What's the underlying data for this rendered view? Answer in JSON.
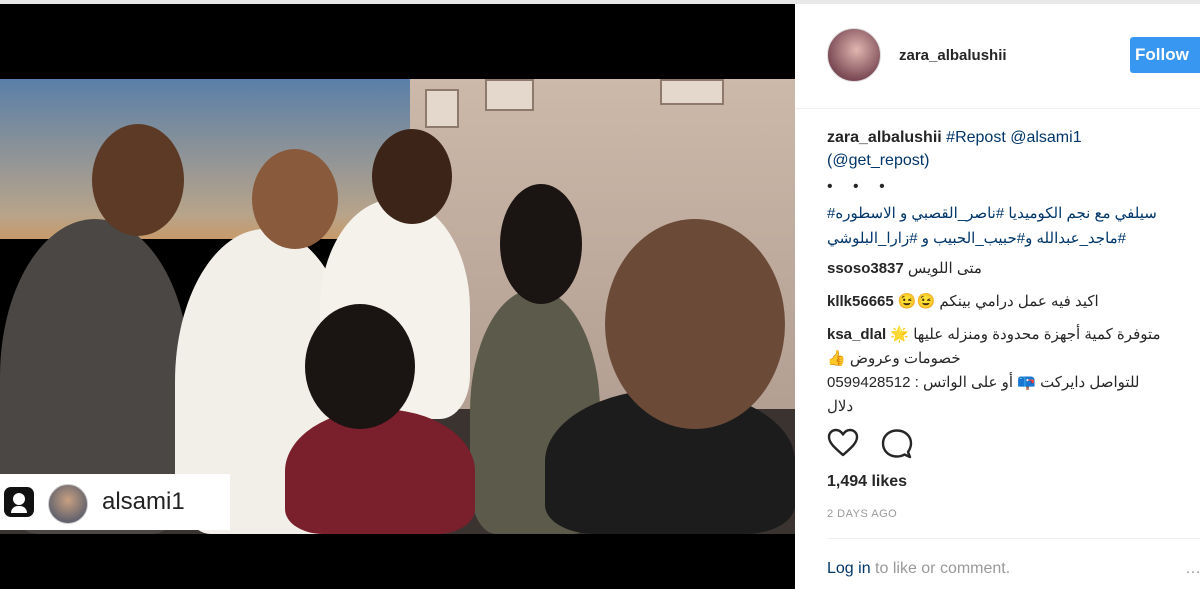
{
  "post": {
    "username": "zara_albalushii",
    "follow_label": "Follow",
    "repost_username": "alsami1"
  },
  "caption": {
    "username": "zara_albalushii",
    "text_part1": "#Repost @alsami1",
    "text_part2": "(@get_repost)",
    "dots": "• • •",
    "arabic_line1": "سيلفي مع نجم الكوميديا #ناصر_القصبي و الاسطوره#",
    "arabic_line2": "#ماجد_عبدالله و#حبيب_الحبيب و #زارا_البلوشي"
  },
  "comments": [
    {
      "username": "ssoso3837",
      "text": "متى اللويس"
    },
    {
      "username": "kllk56665",
      "text": "اكيد فيه عمل درامي بينكم 😉😉"
    },
    {
      "username": "ksa_dlal",
      "text": "متوفرة كمية أجهزة محدودة ومنزله عليها 🌟"
    },
    {
      "username": "",
      "text": "خصومات وعروض 👍"
    },
    {
      "username": "",
      "text": "للتواصل دايركت 📪 أو على الواتس : 0599428512"
    },
    {
      "username": "",
      "text": "دلال"
    }
  ],
  "stats": {
    "likes": "1,494 likes",
    "time_ago": "2 DAYS AGO"
  },
  "footer": {
    "login_link": "Log in",
    "login_rest": " to like or comment.",
    "more": "…"
  },
  "icons": {
    "like": "heart-icon",
    "comment": "comment-icon",
    "repost": "user-square-icon"
  },
  "colors": {
    "follow_bg": "#3897f0",
    "hashtag": "#003569",
    "meta_gray": "#999999"
  }
}
